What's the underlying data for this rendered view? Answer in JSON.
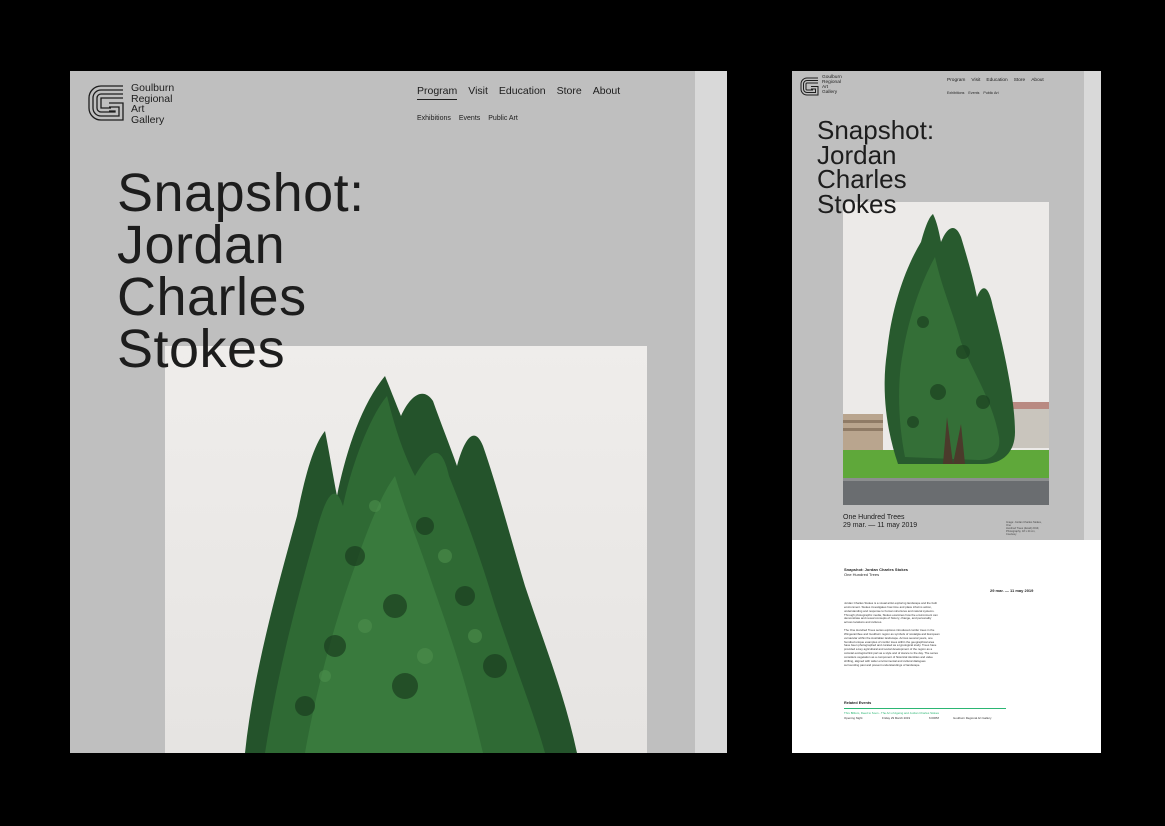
{
  "logo": {
    "lines": [
      "Goulburn",
      "Regional",
      "Art",
      "Gallery"
    ]
  },
  "nav": {
    "items": [
      "Program",
      "Visit",
      "Education",
      "Store",
      "About"
    ],
    "active": "Program",
    "subitems": [
      "Exhibitions",
      "Events",
      "Public Art"
    ]
  },
  "exhibition": {
    "title_lines": [
      "Snapshot:",
      "Jordan",
      "Charles",
      "Stokes"
    ],
    "name": "One Hundred Trees",
    "dates": "29 mar. — 11 may 2019",
    "credit_lines": [
      "Image: Jordan Charles Stokes, One",
      "Hundred Trees (detail) 2019,",
      "Photography, 18 x 24 cm, Courtesy"
    ]
  },
  "detail": {
    "title": "Snapshot: Jordan Charles Stokes",
    "subtitle": "One Hundred Trees",
    "dates": "29 mar. — 11 may 2019",
    "paragraphs": [
      "Jordan Charles Stokes is a visual artist exploring landscape and the built environment. Stokes investigates how time and place informs action, understanding and response to human structures and natural systems. Through photographic media, Stokes examines how the environment can demonstrate and reveal concepts of history, change, and personality across locations and cultures.",
      "The One Hundred Trees series explores introduced conifer trees in the Wingecarribee and Goulburn region as symbols of nostalgia and European vernacular within the Australian landscape. Across several years, one hundred unique examples of conifer trees within the geographical area have been photographed and curated as a typological study. Trees have provided a key agricultural and social development of the region as a colonial ecological link part as a style and of stance to the day. The series considers vegetation as a component of historical identities and value shifting, aligned with wider environmental and cultural dialogues surrounding past and present understandings of landscape."
    ],
    "related_label": "Related Events",
    "event": {
      "link": "Thru Billium, Deed to Soon - The Art of Ageing and Jordan Charles Stokes",
      "type": "Opening Night",
      "date": "Friday 29 March 2019",
      "time": "6:00PM",
      "venue": "Goulburn Regional Art Gallery"
    }
  },
  "colors": {
    "page_bg": "#000000",
    "panel_grey": "#bfbfbf",
    "scrollbar": "#d9d9d9",
    "text": "#1d1d1d",
    "accent_green": "#2bb673"
  }
}
